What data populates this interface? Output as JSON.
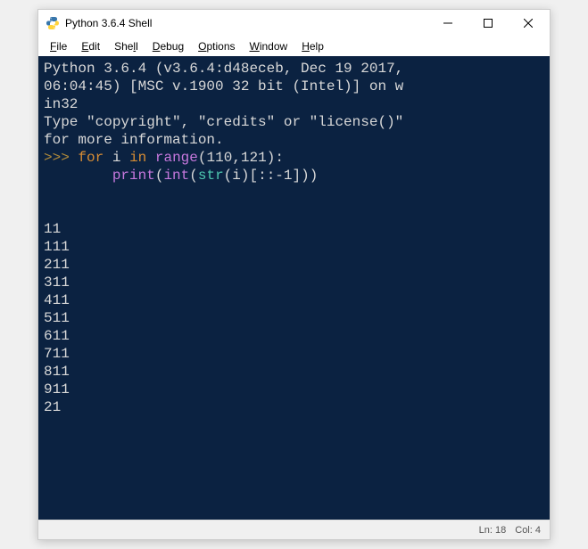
{
  "window": {
    "title": "Python 3.6.4 Shell"
  },
  "menubar": {
    "file": "File",
    "edit": "Edit",
    "shell": "Shell",
    "debug": "Debug",
    "options": "Options",
    "window": "Window",
    "help": "Help"
  },
  "console": {
    "banner_line1": "Python 3.6.4 (v3.6.4:d48eceb, Dec 19 2017,",
    "banner_line2": "06:04:45) [MSC v.1900 32 bit (Intel)] on w",
    "banner_line3": "in32",
    "banner_line4": "Type \"copyright\", \"credits\" or \"license()\"",
    "banner_line5": "for more information.",
    "prompt": ">>>",
    "code": {
      "for": "for",
      "var": "i",
      "in": "in",
      "range": "range",
      "lparen1": "(",
      "arg1": "110",
      "comma": ",",
      "arg2": "121",
      "rparen1": ")",
      "colon": ":",
      "indent": "        ",
      "print": "print",
      "lparen2": "(",
      "int": "int",
      "lparen3": "(",
      "str": "str",
      "lparen4": "(",
      "ivar": "i",
      "rparen4": ")",
      "slice": "[::-1]",
      "rparen3": ")",
      "rparen2": ")"
    },
    "output": [
      "11",
      "111",
      "211",
      "311",
      "411",
      "511",
      "611",
      "711",
      "811",
      "911",
      "21"
    ]
  },
  "statusbar": {
    "line": "Ln: 18",
    "col": "Col: 4"
  }
}
